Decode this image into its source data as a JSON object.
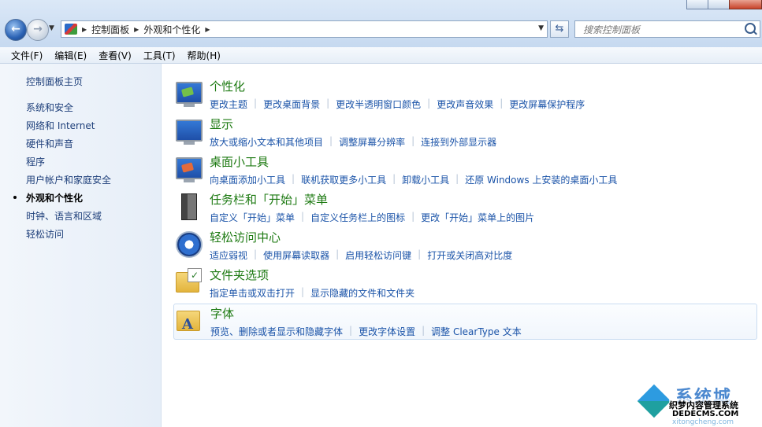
{
  "nav": {
    "breadcrumbs": [
      "控制面板",
      "外观和个性化"
    ],
    "search_placeholder": "搜索控制面板"
  },
  "menu": [
    "文件(F)",
    "编辑(E)",
    "查看(V)",
    "工具(T)",
    "帮助(H)"
  ],
  "sidebar": {
    "home": "控制面板主页",
    "items": [
      {
        "label": "系统和安全"
      },
      {
        "label": "网络和 Internet"
      },
      {
        "label": "硬件和声音"
      },
      {
        "label": "程序"
      },
      {
        "label": "用户帐户和家庭安全"
      },
      {
        "label": "外观和个性化",
        "current": true
      },
      {
        "label": "时钟、语言和区域"
      },
      {
        "label": "轻松访问"
      }
    ]
  },
  "categories": [
    {
      "title": "个性化",
      "icon": "personalization-icon",
      "links": [
        "更改主题",
        "更改桌面背景",
        "更改半透明窗口颜色",
        "更改声音效果",
        "更改屏幕保护程序"
      ]
    },
    {
      "title": "显示",
      "icon": "display-icon",
      "links": [
        "放大或缩小文本和其他项目",
        "调整屏幕分辨率",
        "连接到外部显示器"
      ]
    },
    {
      "title": "桌面小工具",
      "icon": "gadgets-icon",
      "links": [
        "向桌面添加小工具",
        "联机获取更多小工具",
        "卸载小工具",
        "还原 Windows 上安装的桌面小工具"
      ]
    },
    {
      "title": "任务栏和「开始」菜单",
      "icon": "taskbar-icon",
      "links": [
        "自定义「开始」菜单",
        "自定义任务栏上的图标",
        "更改「开始」菜单上的图片"
      ]
    },
    {
      "title": "轻松访问中心",
      "icon": "ease-of-access-icon",
      "links": [
        "适应弱视",
        "使用屏幕读取器",
        "启用轻松访问键",
        "打开或关闭高对比度"
      ]
    },
    {
      "title": "文件夹选项",
      "icon": "folder-options-icon",
      "links": [
        "指定单击或双击打开",
        "显示隐藏的文件和文件夹"
      ]
    },
    {
      "title": "字体",
      "icon": "fonts-icon",
      "links": [
        "预览、删除或者显示和隐藏字体",
        "更改字体设置",
        "调整 ClearType 文本"
      ],
      "hover": true
    }
  ],
  "watermark": {
    "big": "系统城",
    "line1": "织梦内容管理系统",
    "line2": "DEDECMS.COM",
    "line3": "xitongcheng.com"
  }
}
